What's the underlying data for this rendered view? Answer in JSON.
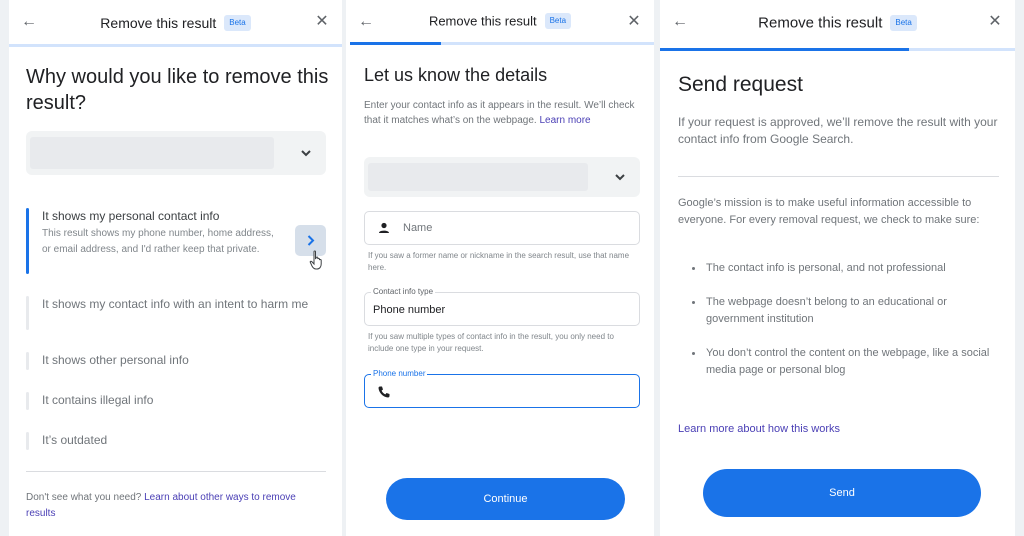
{
  "header": {
    "back_icon": "arrow-left-icon",
    "title": "Remove this result",
    "badge": "Beta",
    "close_icon": "close-icon"
  },
  "colors": {
    "accent": "#1a73e8",
    "progress_track": "#d2e3fc",
    "link": "#4a3fb5"
  },
  "panel1": {
    "progress": 0,
    "heading": "Why would you like to remove this result?",
    "dropdown_icon": "chevron-down-icon",
    "options": [
      {
        "label": "It shows my personal contact info",
        "description": "This result shows my phone number, home address, or email address, and I'd rather keep that private.",
        "active": true
      },
      {
        "label": "It shows my contact info with an intent to harm me"
      },
      {
        "label": "It shows other personal info"
      },
      {
        "label": "It contains illegal info"
      },
      {
        "label": "It’s outdated"
      }
    ],
    "next_icon": "chevron-right-icon",
    "footer_text": "Don't see what you need?",
    "footer_link": "Learn about other ways to remove results"
  },
  "panel2": {
    "progress": 0.3,
    "heading": "Let us know the details",
    "intro": "Enter your contact info as it appears in the result. We’ll check that it matches what’s on the webpage.",
    "intro_link": "Learn more",
    "dropdown_icon": "chevron-down-icon",
    "name_field": {
      "icon": "person-icon",
      "placeholder": "Name",
      "value": ""
    },
    "name_helper": "If you saw a former name or nickname in the search result, use that name here.",
    "contact_type_field": {
      "label": "Contact info type",
      "value": "Phone number"
    },
    "contact_type_helper": "If you saw multiple types of contact info in the result, you only need to include one type in your request.",
    "phone_field": {
      "label": "Phone number",
      "icon": "phone-icon",
      "value": ""
    },
    "continue_label": "Continue"
  },
  "panel3": {
    "progress": 0.7,
    "heading": "Send request",
    "intro": "If your request is approved, we’ll remove the result with your contact info from Google Search.",
    "mission": "Google’s mission is to make useful information accessible to everyone. For every removal request, we check to make sure:",
    "checks": [
      "The contact info is personal, and not professional",
      "The webpage doesn’t belong to an educational or government institution",
      "You don’t control the content on the webpage, like a social media page or personal blog"
    ],
    "learn_link": "Learn more about how this works",
    "send_label": "Send"
  }
}
